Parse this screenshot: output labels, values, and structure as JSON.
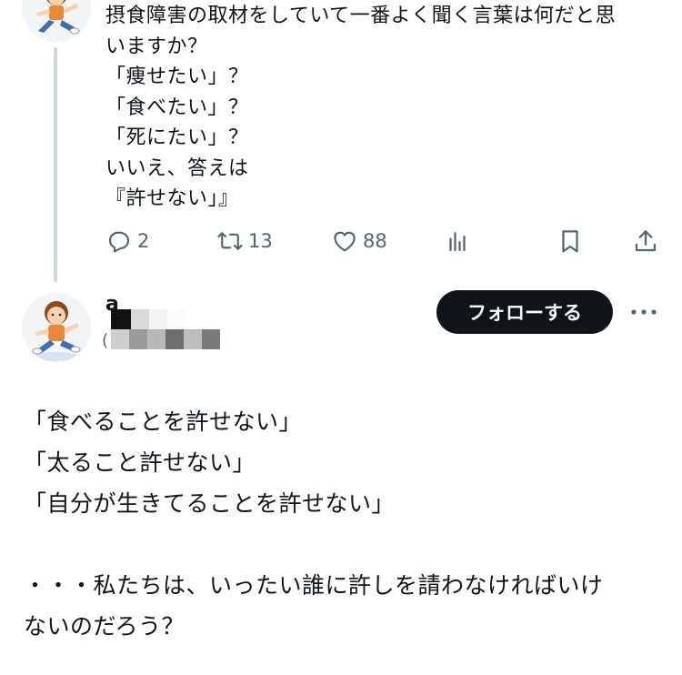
{
  "parent_tweet": {
    "avatar_icon": "runner-girl-avatar-icon",
    "lines": [
      "摂食障害の取材をしていて一番よく聞く言葉は何だと思",
      "いますか？",
      "「痩せたい」？",
      "「食べたい」？",
      "「死にたい」？",
      "いいえ、答えは",
      "『許せない」』"
    ],
    "actions": {
      "reply_count": "2",
      "retweet_count": "13",
      "like_count": "88"
    }
  },
  "main_tweet": {
    "avatar_icon": "runner-girl-avatar-icon",
    "author_name_visible": "a",
    "handle_open_paren": "(",
    "follow_label": "フォローする",
    "lines": [
      "「食べることを許せない」",
      "「太ること許せない」",
      "「自分が生きてることを許せない」",
      "",
      "・・・私たちは、いったい誰に許しを請わなければいけ",
      "ないのだろう？"
    ]
  },
  "colors": {
    "text": "#0f1419",
    "muted": "#536471",
    "thread_line": "#cfd9de",
    "follow_bg": "#0f1419",
    "follow_text": "#ffffff"
  }
}
